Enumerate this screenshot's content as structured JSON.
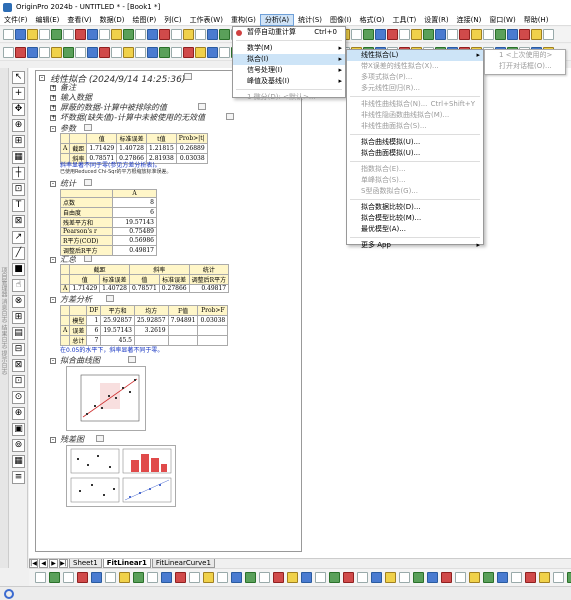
{
  "window": {
    "title": "OriginPro 2024b - UNTITLED * - [Book1 *]"
  },
  "menubar": {
    "items": [
      "文件(F)",
      "编辑(E)",
      "查看(V)",
      "数据(D)",
      "绘图(P)",
      "列(C)",
      "工作表(W)",
      "重构(G)",
      "分析(A)",
      "统计(S)",
      "图像(I)",
      "格式(O)",
      "工具(T)",
      "设置(R)",
      "连接(N)",
      "窗口(W)",
      "帮助(H)"
    ],
    "active_index": 8
  },
  "left_strip": {
    "labels": "项目管理器 消息日志 结果日志 提示日志"
  },
  "report": {
    "title": "线性拟合 (2024/9/14 14:25:36)",
    "notes_label": "备注",
    "input_label": "输入数据",
    "masked_label": "屏蔽的数据-计算中被排除的值",
    "bad_label": "坏数据(缺失值)-计算中未被使用的无效值",
    "params": {
      "label": "参数",
      "headers": [
        "",
        "",
        "值",
        "标准误差",
        "t值",
        "Prob>|t|"
      ],
      "rows": [
        [
          "A",
          "截距",
          "1.71429",
          "1.40728",
          "1.21815",
          "0.26889"
        ],
        [
          "",
          "斜率",
          "0.78571",
          "0.27866",
          "2.81938",
          "0.03038"
        ]
      ],
      "note1": "斜率显著不同于零(参见方差分析表)。",
      "note2": "已使用Reduced Chi-Sqr的平方根缩放标准误差。"
    },
    "stats": {
      "label": "统计",
      "header": "A",
      "rows": [
        [
          "点数",
          "8"
        ],
        [
          "自由度",
          "6"
        ],
        [
          "残差平方和",
          "19.57143"
        ],
        [
          "Pearson's r",
          "0.75489"
        ],
        [
          "R平方(COD)",
          "0.56986"
        ],
        [
          "调整后R平方",
          "0.49817"
        ]
      ]
    },
    "summary": {
      "label": "汇总",
      "group_headers": [
        "截距",
        "斜率",
        "统计"
      ],
      "headers": [
        "值",
        "标准误差",
        "值",
        "标准误差",
        "调整后R平方"
      ],
      "row": [
        "A",
        "1.71429",
        "1.40728",
        "0.78571",
        "0.27866",
        "0.49817"
      ]
    },
    "anova": {
      "label": "方差分析",
      "headers": [
        "",
        "",
        "DF",
        "平方和",
        "均方",
        "F值",
        "Prob>F"
      ],
      "rows": [
        [
          "",
          "模型",
          "1",
          "25.92857",
          "25.92857",
          "7.94891",
          "0.03038"
        ],
        [
          "A",
          "误差",
          "6",
          "19.57143",
          "3.2619",
          "",
          ""
        ],
        [
          "",
          "总计",
          "7",
          "45.5",
          "",
          "",
          ""
        ]
      ],
      "note": "在0.05的水平下，斜率显著不同于零。"
    },
    "fitplot_label": "拟合曲线图",
    "residual_label": "残差图"
  },
  "menu_analysis": {
    "items": [
      {
        "label": "暂停自动重计算",
        "shortcut": "Ctrl+0",
        "disabled": false,
        "arrow": false,
        "sep_after": true
      },
      {
        "label": "数学(M)",
        "shortcut": "",
        "disabled": false,
        "arrow": true,
        "sep_after": false
      },
      {
        "label": "拟合(I)",
        "shortcut": "",
        "disabled": false,
        "arrow": true,
        "sep_after": false,
        "highlight": true
      },
      {
        "label": "信号处理(I)",
        "shortcut": "",
        "disabled": false,
        "arrow": true,
        "sep_after": false
      },
      {
        "label": "峰值及基线(I)",
        "shortcut": "",
        "disabled": false,
        "arrow": true,
        "sep_after": true
      },
      {
        "label": "1 微分(D): <默认>...",
        "shortcut": "",
        "disabled": true,
        "arrow": false,
        "sep_after": false
      }
    ]
  },
  "menu_fit": {
    "items": [
      {
        "label": "线性拟合(L)",
        "shortcut": "",
        "disabled": false,
        "arrow": true,
        "highlight": true,
        "sep_after": false
      },
      {
        "label": "带X误差的线性拟合(X)...",
        "shortcut": "",
        "disabled": true,
        "arrow": false,
        "sep_after": false
      },
      {
        "label": "多项式拟合(P)...",
        "shortcut": "",
        "disabled": true,
        "arrow": false,
        "sep_after": false
      },
      {
        "label": "多元线性回归(R)...",
        "shortcut": "",
        "disabled": true,
        "arrow": false,
        "sep_after": true
      },
      {
        "label": "非线性曲线拟合(N)...",
        "shortcut": "Ctrl+Shift+Y",
        "disabled": true,
        "arrow": false,
        "sep_after": false
      },
      {
        "label": "非线性隐函数曲线拟合(M)...",
        "shortcut": "",
        "disabled": true,
        "arrow": false,
        "sep_after": false
      },
      {
        "label": "非线性曲面拟合(S)...",
        "shortcut": "",
        "disabled": true,
        "arrow": false,
        "sep_after": true
      },
      {
        "label": "拟合曲线模拟(U)...",
        "shortcut": "",
        "disabled": false,
        "arrow": false,
        "sep_after": false
      },
      {
        "label": "拟合曲面模拟(U)...",
        "shortcut": "",
        "disabled": false,
        "arrow": false,
        "sep_after": true
      },
      {
        "label": "指数拟合(E)...",
        "shortcut": "",
        "disabled": true,
        "arrow": false,
        "sep_after": false
      },
      {
        "label": "单峰拟合(S)...",
        "shortcut": "",
        "disabled": true,
        "arrow": false,
        "sep_after": false
      },
      {
        "label": "S型函数拟合(G)...",
        "shortcut": "",
        "disabled": true,
        "arrow": false,
        "sep_after": true
      },
      {
        "label": "拟合数据比较(D)...",
        "shortcut": "",
        "disabled": false,
        "arrow": false,
        "sep_after": false
      },
      {
        "label": "拟合模型比较(M)...",
        "shortcut": "",
        "disabled": false,
        "arrow": false,
        "sep_after": false
      },
      {
        "label": "最优模型(A)...",
        "shortcut": "",
        "disabled": false,
        "arrow": false,
        "sep_after": true
      },
      {
        "label": "更多 App",
        "shortcut": "",
        "disabled": false,
        "arrow": true,
        "sep_after": false
      }
    ]
  },
  "menu_linear": {
    "items": [
      {
        "label": "1 <上次使用的>",
        "disabled": true
      },
      {
        "label": "打开对话框(O)...",
        "disabled": true
      }
    ]
  },
  "sheet_tabs": {
    "nav": [
      "|◀",
      "◀",
      "▶",
      "▶|"
    ],
    "tabs": [
      "Sheet1",
      "FitLinear1",
      "FitLinearCurve1"
    ],
    "active_index": 1
  }
}
